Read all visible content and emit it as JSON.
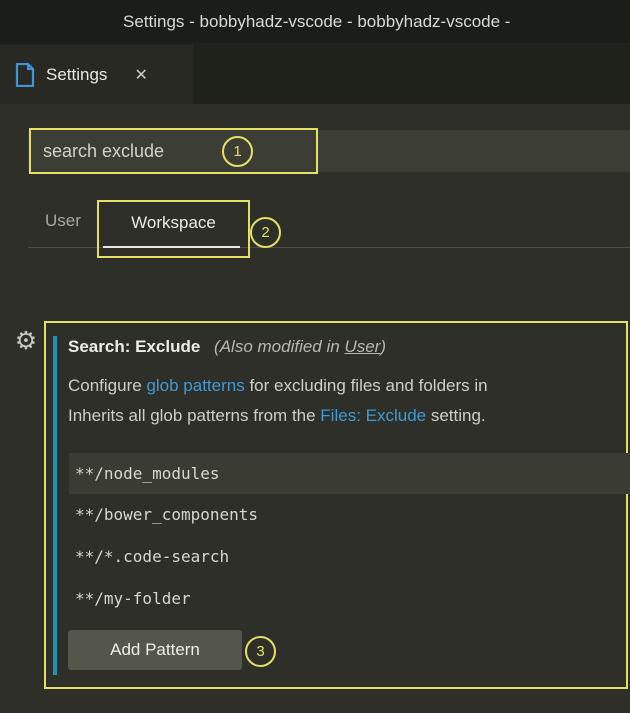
{
  "colors": {
    "annotation_yellow": "#e4e066",
    "modified_indicator_teal": "#2093b3",
    "link_blue": "#3f9ad6",
    "background": "#2d2f28",
    "titlebar": "#1b1d18",
    "search_input_bg": "#3c3e36",
    "selected_row_bg": "#3a3c34",
    "button_bg": "#54554b",
    "file_icon_blue": "#3d96d9"
  },
  "window": {
    "title": "Settings - bobbyhadz-vscode - bobbyhadz-vscode -"
  },
  "tab": {
    "label": "Settings",
    "close_glyph": "✕"
  },
  "icons": {
    "file_icon": "document-outline",
    "gear_icon": "⚙"
  },
  "search": {
    "value": "search exclude"
  },
  "scope_tabs": {
    "user": "User",
    "workspace": "Workspace",
    "selected": "Workspace"
  },
  "annotations": {
    "step1": "1",
    "step2": "2",
    "step3": "3"
  },
  "setting": {
    "title_category": "Search:",
    "title_name": "Exclude",
    "modified_note_prefix": "(Also modified in ",
    "modified_note_link": "User",
    "modified_note_suffix": ")",
    "desc1_pre": "Configure ",
    "desc1_link": "glob patterns",
    "desc1_post": " for excluding files and folders in",
    "desc2_pre": "Inherits all glob patterns from the ",
    "desc2_link": "Files: Exclude",
    "desc2_post": " setting.",
    "patterns": [
      "**/node_modules",
      "**/bower_components",
      "**/*.code-search",
      "**/my-folder"
    ],
    "selected_pattern_index": 0,
    "add_button_label": "Add Pattern"
  }
}
